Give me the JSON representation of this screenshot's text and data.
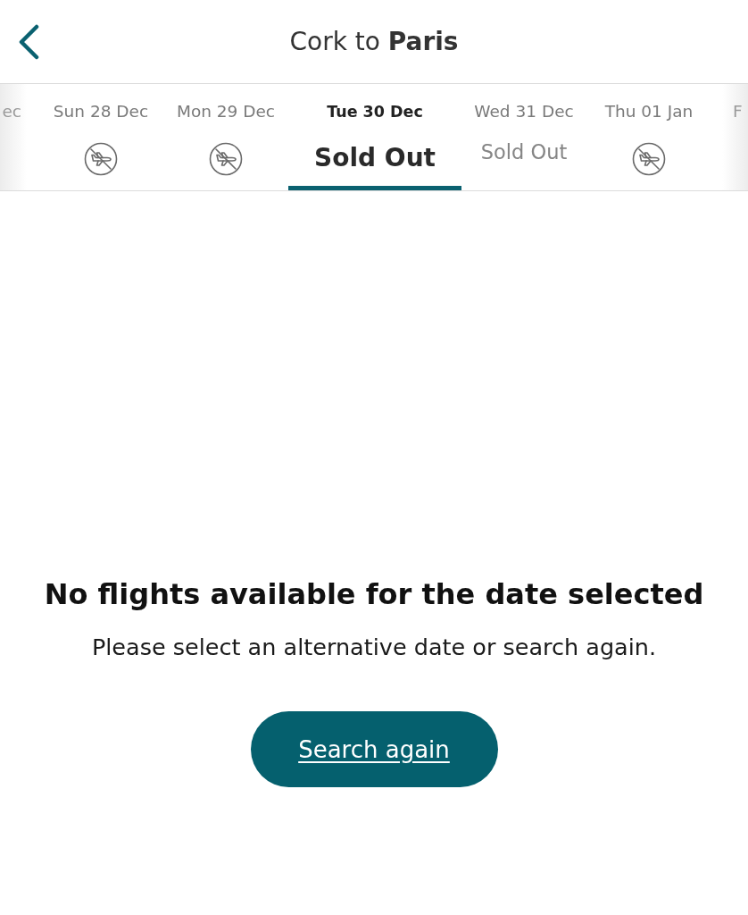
{
  "header": {
    "title": "Cork to **Paris**"
  },
  "date_strip": {
    "dates": [
      {
        "label": "ec",
        "selected": false
      },
      {
        "label": "Sun 28 Dec",
        "selected": false,
        "kind": "no_flights"
      },
      {
        "label": "Mon 29 Dec",
        "selected": false,
        "kind": "no_flights"
      },
      {
        "label": "Tue 30 Dec",
        "selected": true,
        "kind": "sold_out",
        "status": "Sold Out"
      },
      {
        "label": "Wed 31 Dec",
        "selected": false,
        "kind": "sold_out",
        "status": "Sold Out"
      },
      {
        "label": "Thu 01 Jan",
        "selected": false,
        "kind": "no_flights"
      },
      {
        "label": "F",
        "selected": false
      }
    ]
  },
  "empty_state": {
    "title": "No flights available for the date selected",
    "message": "Please select an alternative date or search again.",
    "button": "Search again"
  }
}
